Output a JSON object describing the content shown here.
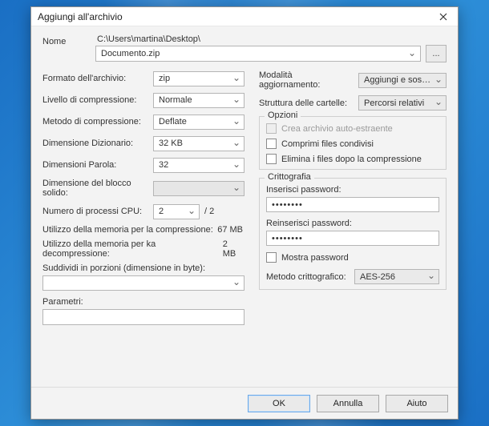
{
  "window": {
    "title": "Aggiungi all'archivio"
  },
  "name": {
    "label": "Nome",
    "path": "C:\\Users\\martina\\Desktop\\",
    "filename": "Documento.zip",
    "browse": "..."
  },
  "left": {
    "format_label": "Formato dell'archivio:",
    "format_value": "zip",
    "level_label": "Livello di compressione:",
    "level_value": "Normale",
    "method_label": "Metodo di compressione:",
    "method_value": "Deflate",
    "dict_label": "Dimensione Dizionario:",
    "dict_value": "32 KB",
    "word_label": "Dimensioni Parola:",
    "word_value": "32",
    "solid_label": "Dimensione del blocco solido:",
    "solid_value": "",
    "cpu_label": "Numero di processi CPU:",
    "cpu_value": "2",
    "cpu_suffix": "/ 2",
    "mem_comp_label": "Utilizzo della memoria per la compressione:",
    "mem_comp_value": "67 MB",
    "mem_decomp_label": "Utilizzo della memoria per ka decompressione:",
    "mem_decomp_value": "2 MB",
    "split_label": "Suddividi in porzioni (dimensione in byte):",
    "split_value": "",
    "params_label": "Parametri:",
    "params_value": ""
  },
  "right": {
    "update_label": "Modalità aggiornamento:",
    "update_value": "Aggiungi e sostituisci i files",
    "paths_label": "Struttura delle cartelle:",
    "paths_value": "Percorsi relativi",
    "options": {
      "title": "Opzioni",
      "sfx": "Crea archivio auto-estraente",
      "shared": "Comprimi files condivisi",
      "delete": "Elimina i files dopo la compressione"
    },
    "crypto": {
      "title": "Crittografia",
      "pw_label": "Inserisci password:",
      "pw_value": "••••••••",
      "repw_label": "Reinserisci password:",
      "repw_value": "••••••••",
      "show_pw": "Mostra password",
      "method_label": "Metodo crittografico:",
      "method_value": "AES-256"
    }
  },
  "footer": {
    "ok": "OK",
    "cancel": "Annulla",
    "help": "Aiuto"
  }
}
